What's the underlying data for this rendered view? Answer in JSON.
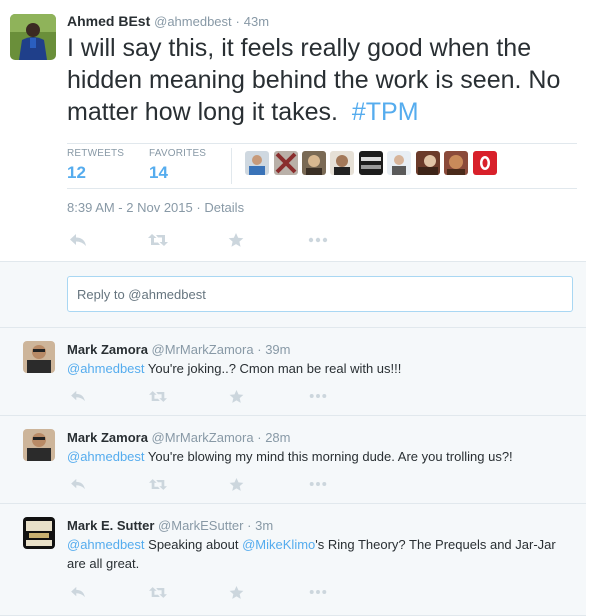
{
  "main_tweet": {
    "fullname": "Ahmed BEst",
    "handle": "@ahmedbest",
    "sep": "·",
    "time": "43m",
    "text": "I will say this, it feels really good when the hidden meaning behind the work is seen. No matter how long it takes.",
    "hashtag": "#TPM",
    "retweets_label": "RETWEETS",
    "retweets_count": "12",
    "favorites_label": "FAVORITES",
    "favorites_count": "14",
    "timestamp": "8:39 AM - 2 Nov 2015",
    "details_link": "Details"
  },
  "reply_box": {
    "placeholder": "Reply to @ahmedbest"
  },
  "replies": [
    {
      "fullname": "Mark Zamora",
      "handle": "@MrMarkZamora",
      "sep": "·",
      "time": "39m",
      "mention": "@ahmedbest",
      "text": " You're joking..? Cmon man be real with us!!!"
    },
    {
      "fullname": "Mark Zamora",
      "handle": "@MrMarkZamora",
      "sep": "·",
      "time": "28m",
      "mention": "@ahmedbest",
      "text": " You're blowing my mind this morning dude. Are you trolling us?!"
    },
    {
      "fullname": "Mark E. Sutter",
      "handle": "@MarkESutter",
      "sep": "·",
      "time": "3m",
      "mention": "@ahmedbest",
      "text_a": " Speaking about ",
      "mention2": "@MikeKlimo",
      "text_b": "'s Ring Theory? The Prequels and Jar-Jar are all great."
    }
  ],
  "icons": {
    "reply": "reply-icon",
    "retweet": "retweet-icon",
    "favorite": "star-icon",
    "more": "more-icon"
  },
  "colors": {
    "accent": "#55acee",
    "muted": "#8899a6",
    "text": "#292f33",
    "reply_bg": "#f5f8fa",
    "border": "#e1e8ed"
  }
}
